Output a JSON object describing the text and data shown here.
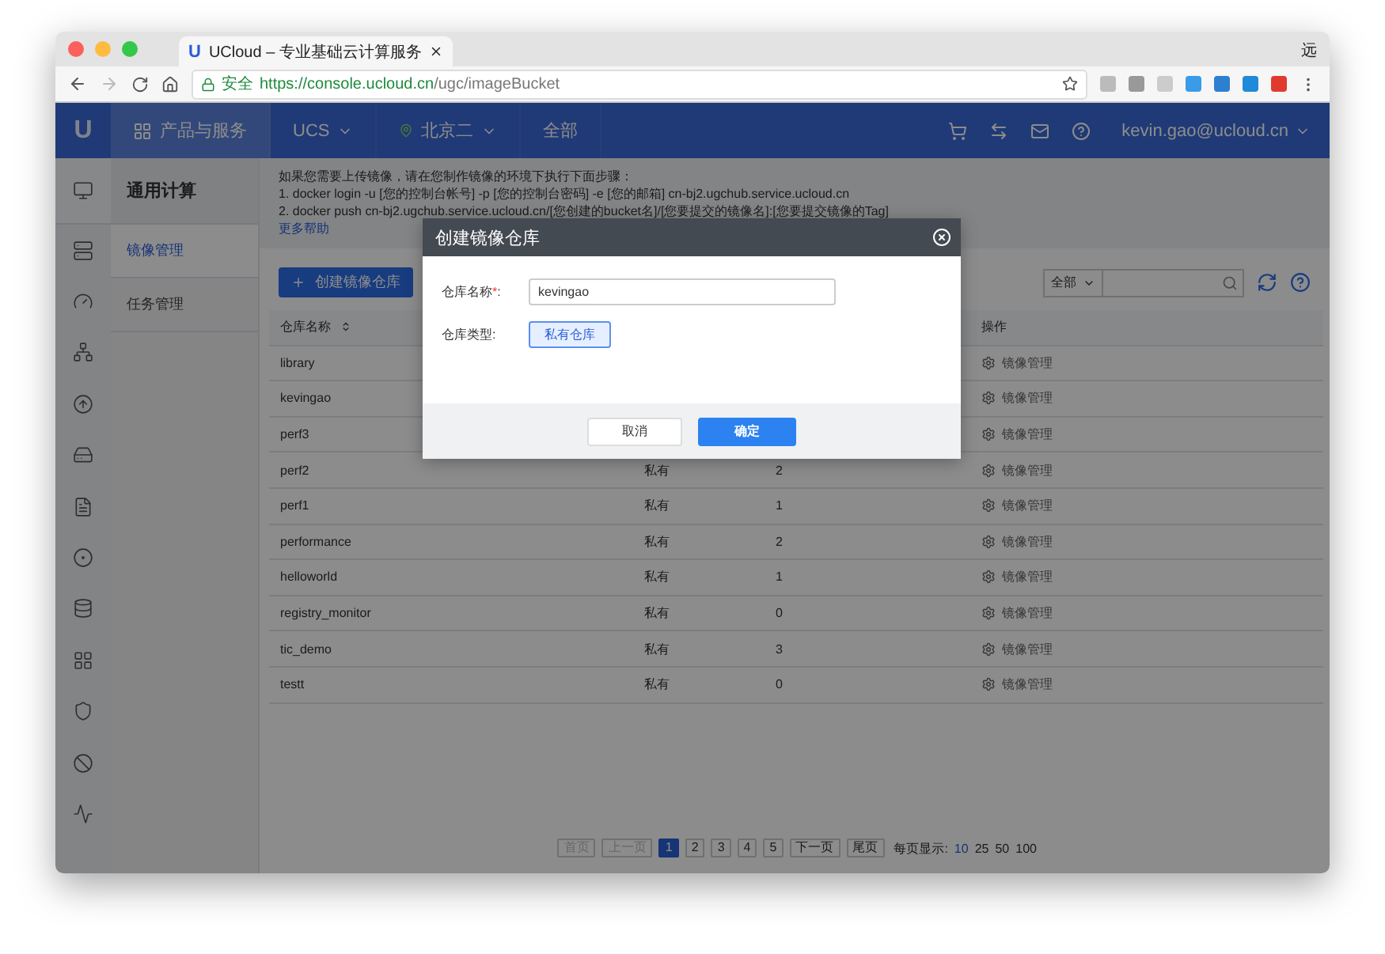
{
  "browser": {
    "tab_logo": "U",
    "tab_title": "UCloud – 专业基础云计算服务",
    "profile": "远",
    "secure_label": "安全",
    "url_scheme": "https://",
    "url_host": "console.ucloud.cn",
    "url_path": "/ugc/imageBucket"
  },
  "header": {
    "logo": "U",
    "nav": [
      {
        "label": "产品与服务",
        "kind": "grid",
        "selected": true
      },
      {
        "label": "UCS",
        "kind": "dropdown",
        "selected": false
      },
      {
        "label": "北京二",
        "kind": "region",
        "selected": false
      },
      {
        "label": "全部",
        "kind": "plain",
        "selected": false
      }
    ],
    "user": "kevin.gao@ucloud.cn"
  },
  "sidebar": {
    "title": "通用计算",
    "items": [
      {
        "label": "镜像管理",
        "selected": true
      },
      {
        "label": "任务管理",
        "selected": false
      }
    ]
  },
  "help": {
    "lines": [
      "如果您需要上传镜像，请在您制作镜像的环境下执行下面步骤：",
      "1. docker login -u [您的控制台帐号] -p [您的控制台密码] -e [您的邮箱] cn-bj2.ugchub.service.ucloud.cn",
      "2. docker push cn-bj2.ugchub.service.ucloud.cn/[您创建的bucket名]/[您要提交的镜像名]:[您要提交镜像的Tag]"
    ],
    "link": "更多帮助"
  },
  "create_button": "创建镜像仓库",
  "filter": {
    "value": "全部"
  },
  "table": {
    "columns": [
      {
        "label": "仓库名称",
        "sortable": true
      },
      {
        "label": "操作"
      }
    ],
    "rows": [
      {
        "name": "library",
        "action": "镜像管理"
      },
      {
        "name": "kevingao",
        "action": "镜像管理"
      },
      {
        "name": "perf3",
        "action": "镜像管理"
      },
      {
        "name": "perf2",
        "type": "私有",
        "count": "2",
        "action": "镜像管理"
      },
      {
        "name": "perf1",
        "type": "私有",
        "count": "1",
        "action": "镜像管理"
      },
      {
        "name": "performance",
        "type": "私有",
        "count": "2",
        "action": "镜像管理"
      },
      {
        "name": "helloworld",
        "type": "私有",
        "count": "1",
        "action": "镜像管理"
      },
      {
        "name": "registry_monitor",
        "type": "私有",
        "count": "0",
        "action": "镜像管理"
      },
      {
        "name": "tic_demo",
        "type": "私有",
        "count": "3",
        "action": "镜像管理"
      },
      {
        "name": "testt",
        "type": "私有",
        "count": "0",
        "action": "镜像管理"
      }
    ]
  },
  "pagination": {
    "items": [
      {
        "label": "首页",
        "disabled": true,
        "selected": false
      },
      {
        "label": "上一页",
        "disabled": true,
        "selected": false
      },
      {
        "label": "1",
        "disabled": false,
        "selected": true
      },
      {
        "label": "2",
        "disabled": false,
        "selected": false
      },
      {
        "label": "3",
        "disabled": false,
        "selected": false
      },
      {
        "label": "4",
        "disabled": false,
        "selected": false
      },
      {
        "label": "5",
        "disabled": false,
        "selected": false
      },
      {
        "label": "下一页",
        "disabled": false,
        "selected": false
      },
      {
        "label": "尾页",
        "disabled": false,
        "selected": false
      }
    ],
    "per_page_label": "每页显示:",
    "per_page_options": [
      {
        "label": "10",
        "selected": true
      },
      {
        "label": "25",
        "selected": false
      },
      {
        "label": "50",
        "selected": false
      },
      {
        "label": "100",
        "selected": false
      }
    ]
  },
  "dialog": {
    "title": "创建镜像仓库",
    "name_field": {
      "label": "仓库名称",
      "required_mark": "*",
      "label_end": ":",
      "value": "kevingao"
    },
    "type_field": {
      "label": "仓库类型:",
      "options": [
        {
          "label": "私有仓库",
          "selected": true
        }
      ]
    },
    "buttons": [
      {
        "label": "取消",
        "kind": "secondary"
      },
      {
        "label": "确定",
        "kind": "primary"
      }
    ]
  }
}
